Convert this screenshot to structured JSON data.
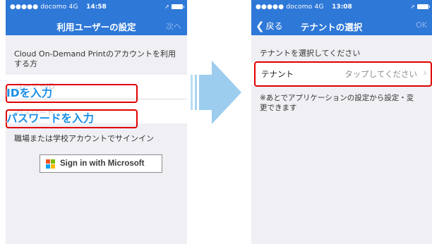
{
  "left_screen": {
    "status": {
      "carrier": "●●●●● docomo  4G",
      "time": "14:58"
    },
    "nav": {
      "title": "利用ユーザーの設定",
      "right_button": "次へ"
    },
    "section_header": "Cloud On-Demand Printのアカウントを利用する方",
    "id_field": {
      "placeholder": "ユーザーID"
    },
    "password_field": {
      "placeholder": "パスワード"
    },
    "annotation_id": "IDを入力",
    "annotation_password": "パスワードを入力",
    "work_account_label": "職場または学校アカウントでサインイン",
    "ms_button_label": "Sign in with Microsoft"
  },
  "right_screen": {
    "status": {
      "carrier": "●●●●● docomo  4G",
      "time": "13:08"
    },
    "nav": {
      "back_label": "戻る",
      "title": "テナントの選択",
      "right_button": "OK"
    },
    "section_header": "テナントを選択してください",
    "tenant_row": {
      "label": "テナント",
      "value": "タップしてください",
      "chevron": "›"
    },
    "note": "※あとでアプリケーションの設定から設定・変更できます"
  },
  "colors": {
    "nav_blue": "#2e78d8",
    "highlight_red": "#e00000",
    "annotation_blue": "#1b8fe6",
    "arrow_blue": "#9ccdee",
    "ms_red": "#f25022",
    "ms_green": "#7fba00",
    "ms_blue": "#00a4ef",
    "ms_yellow": "#ffb900"
  },
  "icons": [
    "battery-icon",
    "signal-dots-icon",
    "back-chevron-icon",
    "disclosure-chevron-icon",
    "microsoft-logo-icon",
    "next-arrow-icon"
  ]
}
